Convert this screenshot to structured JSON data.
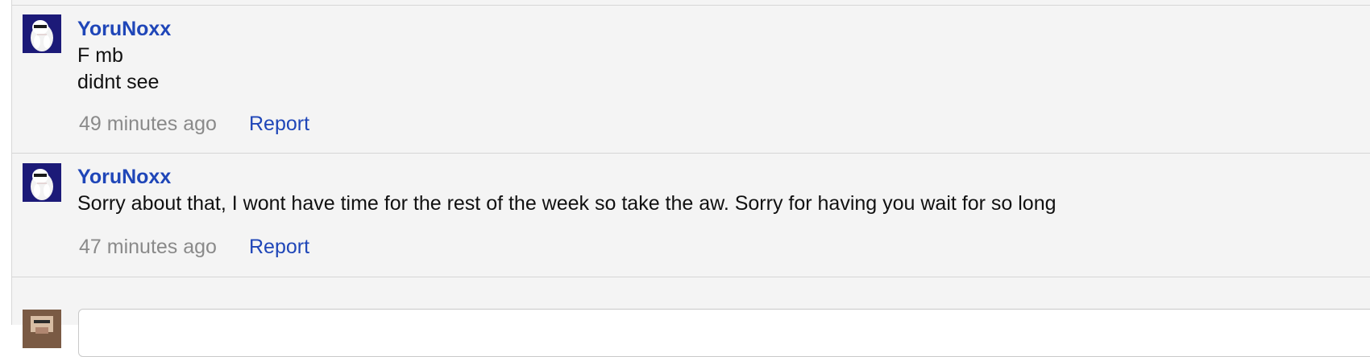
{
  "comments": [
    {
      "author": "YoruNoxx",
      "lines": [
        "F mb",
        "didnt see"
      ],
      "timestamp": "49 minutes ago",
      "report_label": "Report",
      "avatar_icon": "character-avatar-icon"
    },
    {
      "author": "YoruNoxx",
      "lines": [
        "Sorry about that, I wont have time for the rest of the week so take the aw. Sorry for having you wait for so long"
      ],
      "timestamp": "47 minutes ago",
      "report_label": "Report",
      "avatar_icon": "character-avatar-icon"
    }
  ],
  "composer": {
    "avatar_icon": "user-avatar-icon"
  },
  "colors": {
    "link": "#1f46b8",
    "text": "#111111",
    "muted": "#8a8a8a",
    "background": "#f4f4f4",
    "divider": "#d6d6d6"
  }
}
